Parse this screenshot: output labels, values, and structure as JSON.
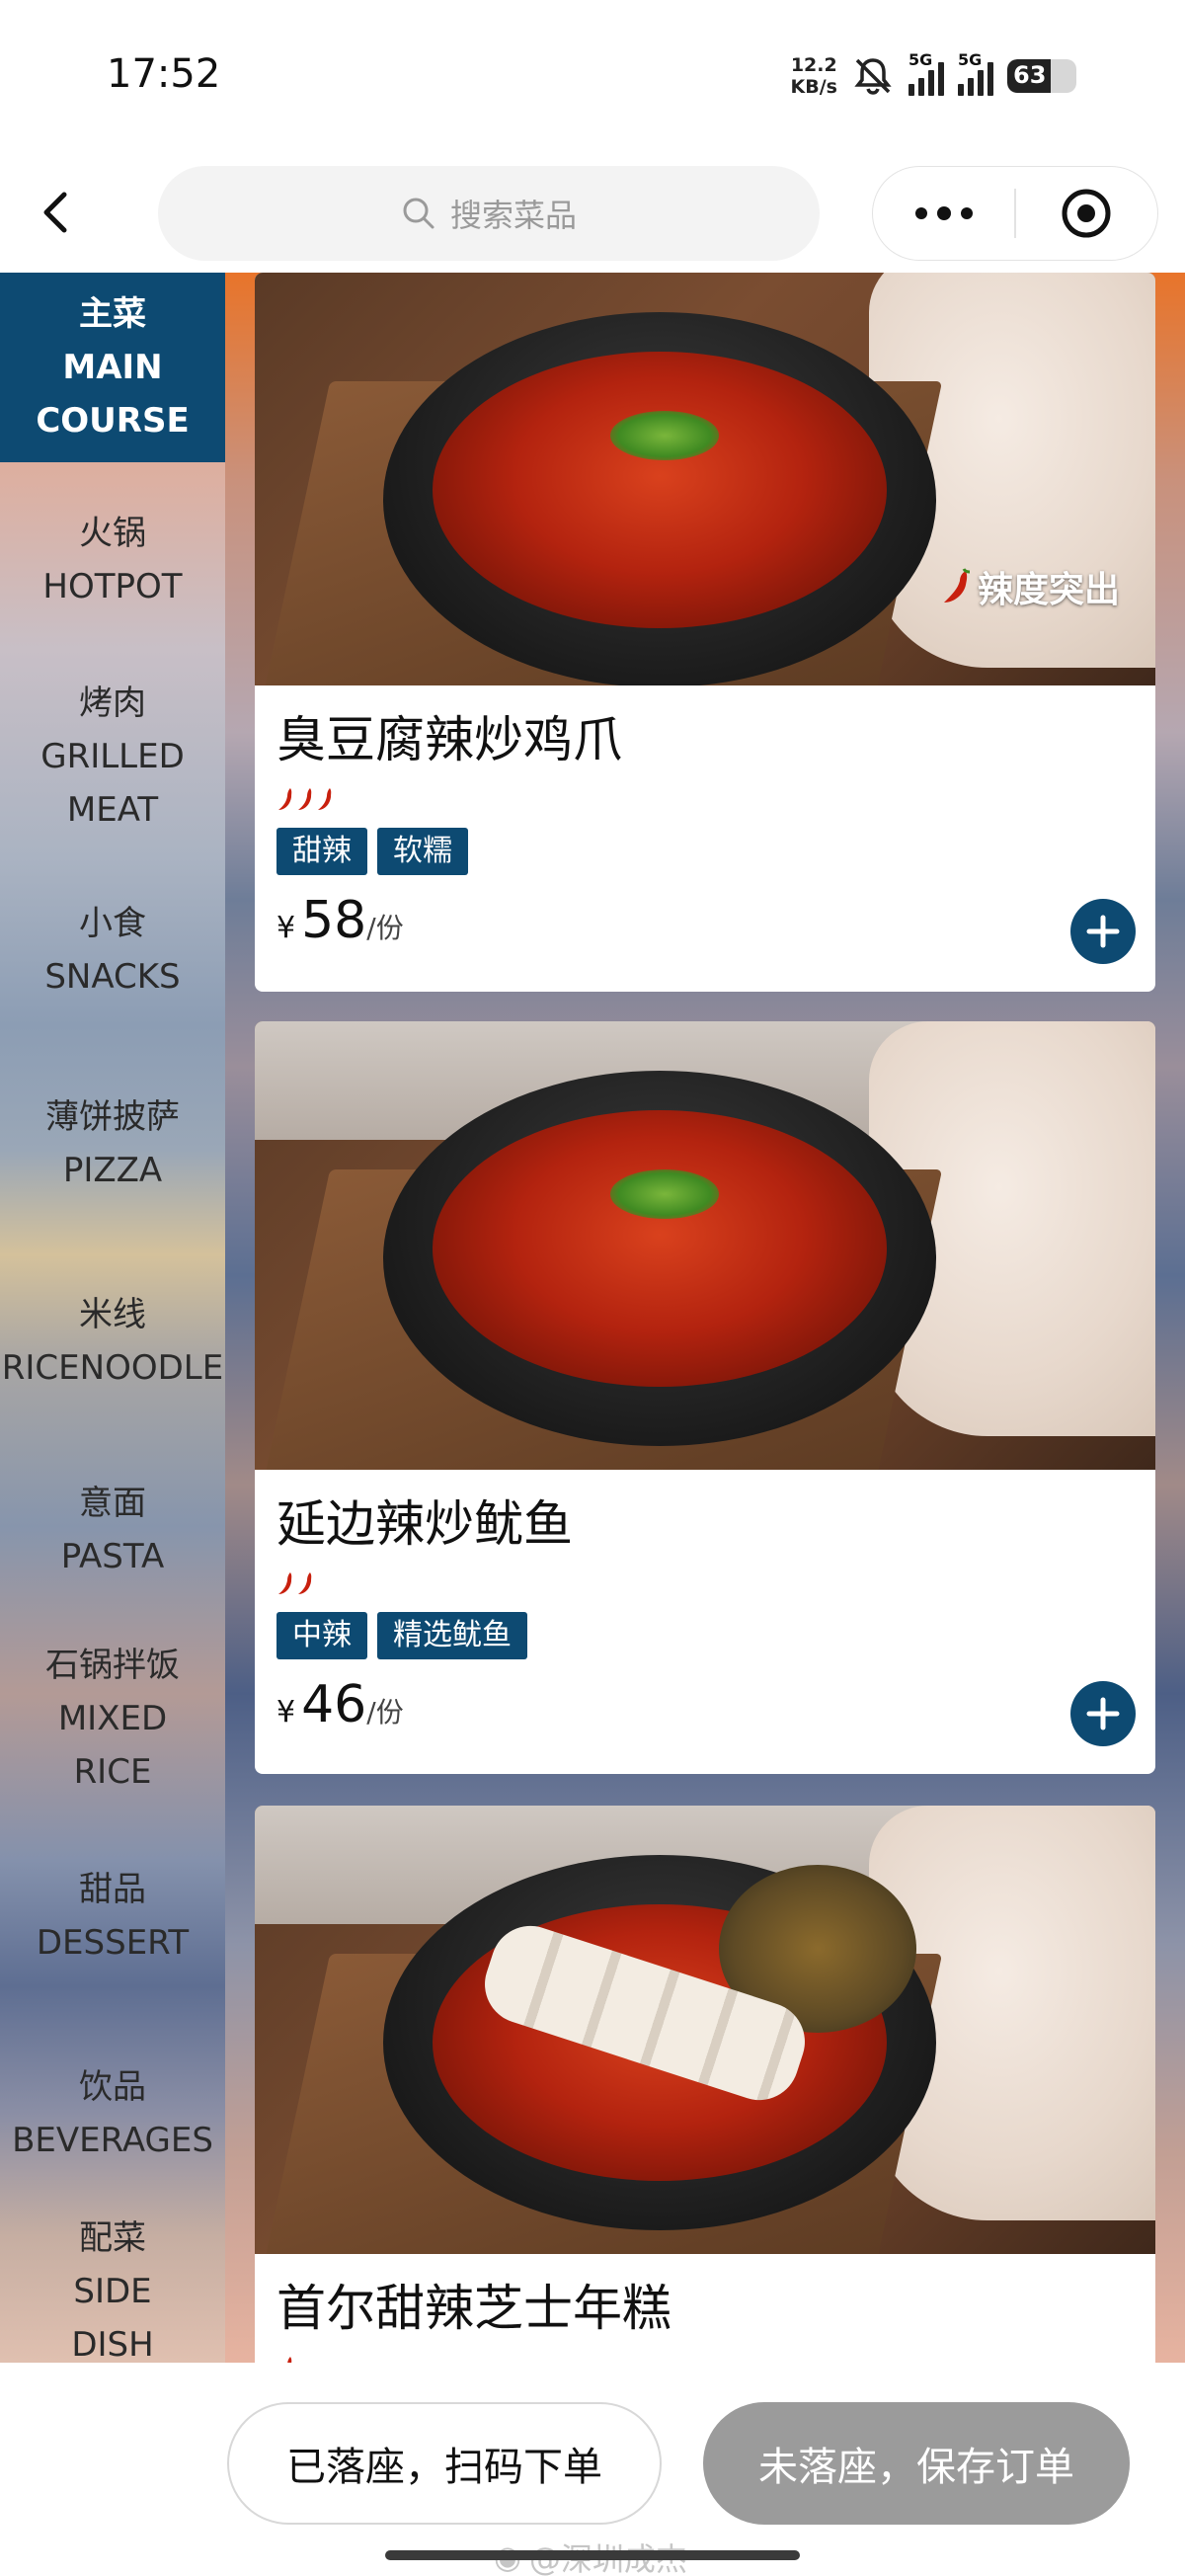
{
  "status_bar": {
    "time": "17:52",
    "net_speed_value": "12.2",
    "net_speed_unit": "KB/s",
    "sim1_label": "5G",
    "sim2_label": "5G",
    "battery_level": "63"
  },
  "header": {
    "search_placeholder": "搜索菜品",
    "back_icon": "chevron-left-icon",
    "more_icon": "more-dots-icon",
    "close_icon": "target-circle-icon"
  },
  "sidebar": {
    "items": [
      {
        "cn": "主菜",
        "en": [
          "MAIN",
          "COURSE"
        ],
        "active": true
      },
      {
        "cn": "火锅",
        "en": [
          "HOTPOT"
        ],
        "active": false
      },
      {
        "cn": "烤肉",
        "en": [
          "GRILLED",
          "MEAT"
        ],
        "active": false
      },
      {
        "cn": "小食",
        "en": [
          "SNACKS"
        ],
        "active": false
      },
      {
        "cn": "薄饼披萨",
        "en": [
          "PIZZA"
        ],
        "active": false
      },
      {
        "cn": "米线",
        "en": [
          "RICENOODLE"
        ],
        "active": false
      },
      {
        "cn": "意面",
        "en": [
          "PASTA"
        ],
        "active": false
      },
      {
        "cn": "石锅拌饭",
        "en": [
          "MIXED",
          "RICE"
        ],
        "active": false
      },
      {
        "cn": "甜品",
        "en": [
          "DESSERT"
        ],
        "active": false
      },
      {
        "cn": "饮品",
        "en": [
          "BEVERAGES"
        ],
        "active": false
      },
      {
        "cn": "配菜",
        "en": [
          "SIDE",
          "DISH"
        ],
        "active": false
      }
    ]
  },
  "dishes": [
    {
      "name": "臭豆腐辣炒鸡爪",
      "spice_level": 3,
      "tags": [
        "甜辣",
        "软糯"
      ],
      "currency": "¥",
      "price": "58",
      "unit": "/份",
      "badge": "辣度突出"
    },
    {
      "name": "延边辣炒鱿鱼",
      "spice_level": 2,
      "tags": [
        "中辣",
        "精选鱿鱼"
      ],
      "currency": "¥",
      "price": "46",
      "unit": "/份"
    },
    {
      "name": "首尔甜辣芝士年糕",
      "spice_level": 1
    }
  ],
  "bottom_bar": {
    "seated_label": "已落座，扫码下单",
    "not_seated_label": "未落座，保存订单",
    "watermark": "@深圳成杰"
  },
  "colors": {
    "accent": "#0d4a72",
    "save_button": "#9b9b9b",
    "chili": "#c8200e"
  }
}
